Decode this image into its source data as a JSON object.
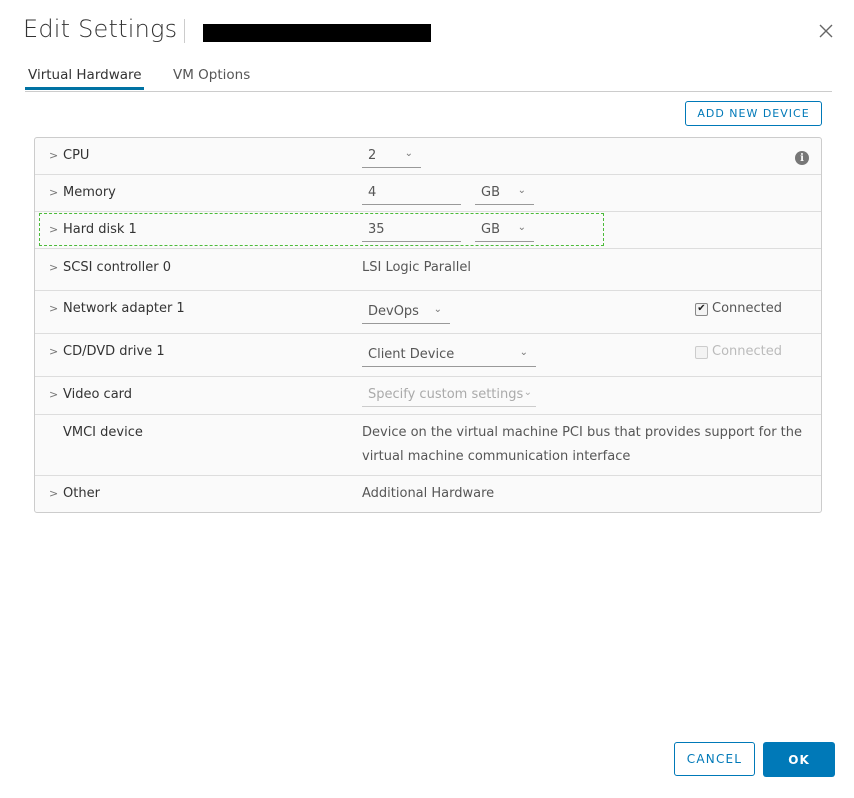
{
  "dialog": {
    "title": "Edit Settings",
    "close_icon": "close-icon"
  },
  "tabs": [
    {
      "label": "Virtual Hardware",
      "active": true
    },
    {
      "label": "VM Options",
      "active": false
    }
  ],
  "toolbar": {
    "add_new_device_label": "ADD NEW DEVICE"
  },
  "hardware": {
    "cpu": {
      "label": "CPU",
      "value": "2"
    },
    "memory": {
      "label": "Memory",
      "value": "4",
      "unit": "GB"
    },
    "hard_disk": {
      "label": "Hard disk 1",
      "value": "35",
      "unit": "GB"
    },
    "scsi": {
      "label": "SCSI controller 0",
      "value": "LSI Logic Parallel"
    },
    "network": {
      "label": "Network adapter 1",
      "value": "DevOps",
      "connected_label": "Connected",
      "connected": true
    },
    "cddvd": {
      "label": "CD/DVD drive 1",
      "value": "Client Device",
      "connected_label": "Connected",
      "connected": false
    },
    "video": {
      "label": "Video card",
      "value": "Specify custom settings"
    },
    "vmci": {
      "label": "VMCI device",
      "line1": "Device on the virtual machine PCI bus that provides support for the",
      "line2": "virtual machine communication interface"
    },
    "other": {
      "label": "Other",
      "value": "Additional Hardware"
    }
  },
  "footer": {
    "cancel_label": "CANCEL",
    "ok_label": "OK"
  },
  "colors": {
    "accent": "#0079b8",
    "highlight_border": "#4cbb3a"
  }
}
